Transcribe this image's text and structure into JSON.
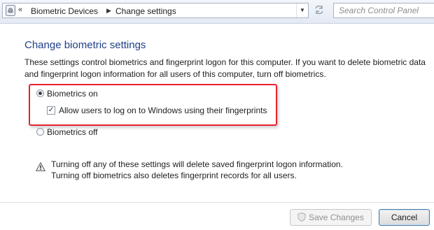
{
  "address_bar": {
    "crumbs": [
      "Biometric Devices",
      "Change settings"
    ]
  },
  "search": {
    "placeholder": "Search Control Panel"
  },
  "main": {
    "title": "Change biometric settings",
    "description_lines": [
      "These settings control biometrics and fingerprint logon for this computer. If you want to delete biometric data",
      "and fingerprint logon information for all users of this computer, turn off biometrics."
    ],
    "biometrics_on": {
      "label": "Biometrics on",
      "selected": true
    },
    "allow_fingerprint": {
      "label": "Allow users to log on to Windows using their fingerprints",
      "checked": true
    },
    "biometrics_off": {
      "label": "Biometrics off",
      "selected": false
    },
    "warning_lines": [
      "Turning off any of these settings will delete saved fingerprint logon information.",
      "Turning off biometrics also deletes fingerprint records for all users."
    ]
  },
  "buttons": {
    "save": "Save Changes",
    "cancel": "Cancel"
  },
  "icons": {
    "address": "fingerprint-icon",
    "refresh": "refresh-icon",
    "warning": "warning-icon",
    "shield": "uac-shield-icon"
  },
  "colors": {
    "title": "#1e3f87",
    "highlight_border": "#e5232e"
  }
}
